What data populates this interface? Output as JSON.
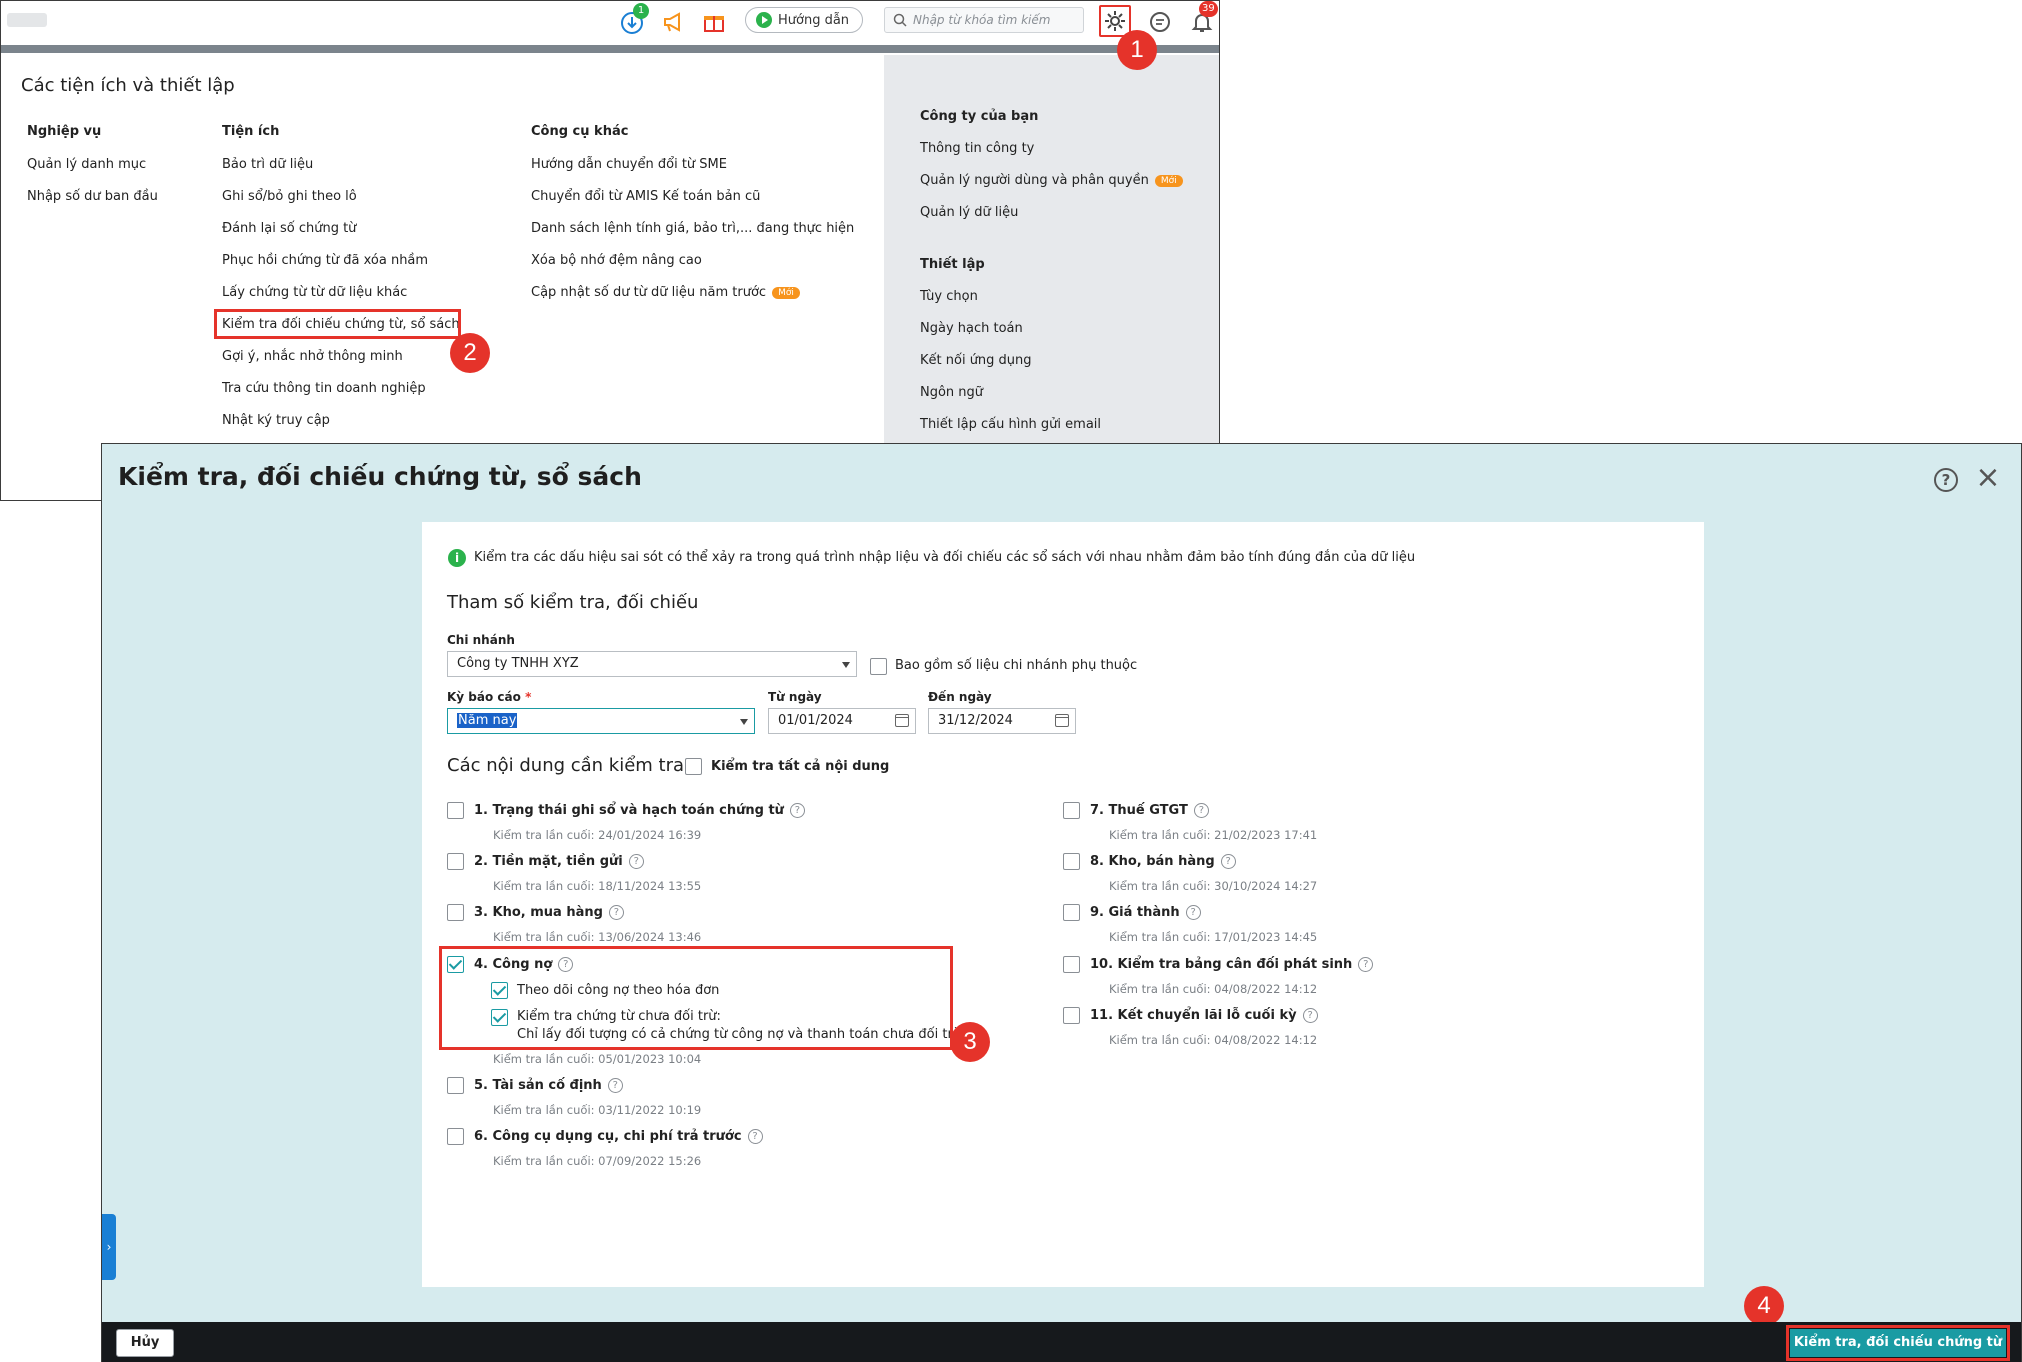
{
  "topbar": {
    "download_badge": "1",
    "guide_label": "Hướng dẫn",
    "search_placeholder": "Nhập từ khóa tìm kiếm",
    "notification_count": "39",
    "colors": {
      "accent": "#1a9ba3",
      "highlight": "#e5332a",
      "green": "#2bb24c",
      "orange": "#f7941d"
    }
  },
  "menu_panel": {
    "title": "Các tiện ích và thiết lập",
    "columns": [
      {
        "heading": "Nghiệp vụ",
        "items": [
          "Quản lý danh mục",
          "Nhập số dư ban đầu"
        ]
      },
      {
        "heading": "Tiện ích",
        "items": [
          "Bảo trì dữ liệu",
          "Ghi sổ/bỏ ghi theo lô",
          "Đánh lại số chứng từ",
          "Phục hồi chứng từ đã xóa nhầm",
          "Lấy chứng từ từ dữ liệu khác",
          "Kiểm tra đối chiếu chứng từ, sổ sách",
          "Gợi ý, nhắc nhở thông minh",
          "Tra cứu thông tin doanh nghiệp",
          "Nhật ký truy cập"
        ]
      },
      {
        "heading": "Công cụ khác",
        "items": [
          "Hướng dẫn chuyển đổi từ SME",
          "Chuyển đổi từ AMIS Kế toán bản cũ",
          "Danh sách lệnh tính giá, bảo trì,... đang thực hiện",
          "Xóa bộ nhớ đệm nâng cao",
          "Cập nhật số dư từ dữ liệu năm trước"
        ]
      }
    ],
    "new_badge": "Mới",
    "right": {
      "company_heading": "Công ty của bạn",
      "company_items": [
        "Thông tin công ty",
        "Quản lý người dùng và phân quyền",
        "Quản lý dữ liệu"
      ],
      "settings_heading": "Thiết lập",
      "settings_items": [
        "Tùy chọn",
        "Ngày hạch toán",
        "Kết nối ứng dụng",
        "Ngôn ngữ",
        "Thiết lập cấu hình gửi email"
      ]
    }
  },
  "steps": [
    "1",
    "2",
    "3",
    "4"
  ],
  "dialog": {
    "title": "Kiểm tra, đối chiếu chứng từ, sổ sách",
    "info": "Kiểm tra các dấu hiệu sai sót có thể xảy ra trong quá trình nhập liệu và đối chiếu các sổ sách với nhau nhằm đảm bảo tính đúng đắn của dữ liệu",
    "params_heading": "Tham số kiểm tra, đối chiếu",
    "branch_label": "Chi nhánh",
    "branch_value": "Công ty TNHH XYZ",
    "include_sub_label": "Bao gồm số liệu chi nhánh phụ thuộc",
    "period_label": "Kỳ báo cáo",
    "period_required": "*",
    "period_value": "Năm nay",
    "from_label": "Từ ngày",
    "from_value": "01/01/2024",
    "to_label": "Đến ngày",
    "to_value": "31/12/2024",
    "content_heading": "Các nội dung cần kiểm tra",
    "check_all_label": "Kiểm tra tất cả nội dung",
    "items_left": [
      {
        "label": "1. Trạng thái ghi sổ và hạch toán chứng từ",
        "last": "Kiểm tra lần cuối: 24/01/2024 16:39",
        "checked": false
      },
      {
        "label": "2. Tiền mặt, tiền gửi",
        "last": "Kiểm tra lần cuối: 18/11/2024 13:55",
        "checked": false
      },
      {
        "label": "3. Kho, mua hàng",
        "last": "Kiểm tra lần cuối: 13/06/2024 13:46",
        "checked": false
      },
      {
        "label": "4. Công nợ",
        "last": "Kiểm tra lần cuối: 05/01/2023 10:04",
        "checked": true
      },
      {
        "label": "5. Tài sản cố định",
        "last": "Kiểm tra lần cuối: 03/11/2022 10:19",
        "checked": false
      },
      {
        "label": "6. Công cụ dụng cụ, chi phí trả trước",
        "last": "Kiểm tra lần cuối: 07/09/2022 15:26",
        "checked": false
      }
    ],
    "cong_no_sub": {
      "opt1": "Theo dõi công nợ theo hóa đơn",
      "opt2_line1": "Kiểm tra chứng từ chưa đối trừ:",
      "opt2_line2": "Chỉ lấy đối tượng có cả chứng từ công nợ và thanh toán chưa đối trừ"
    },
    "items_right": [
      {
        "label": "7. Thuế GTGT",
        "last": "Kiểm tra lần cuối: 21/02/2023 17:41",
        "checked": false
      },
      {
        "label": "8. Kho, bán hàng",
        "last": "Kiểm tra lần cuối: 30/10/2024 14:27",
        "checked": false
      },
      {
        "label": "9. Giá thành",
        "last": "Kiểm tra lần cuối: 17/01/2023 14:45",
        "checked": false
      },
      {
        "label": "10. Kiểm tra bảng cân đối phát sinh",
        "last": "Kiểm tra lần cuối: 04/08/2022 14:12",
        "checked": false
      },
      {
        "label": "11. Kết chuyển lãi lỗ cuối kỳ",
        "last": "Kiểm tra lần cuối: 04/08/2022 14:12",
        "checked": false
      }
    ],
    "cancel_label": "Hủy",
    "submit_label": "Kiểm tra, đối chiếu chứng từ"
  }
}
